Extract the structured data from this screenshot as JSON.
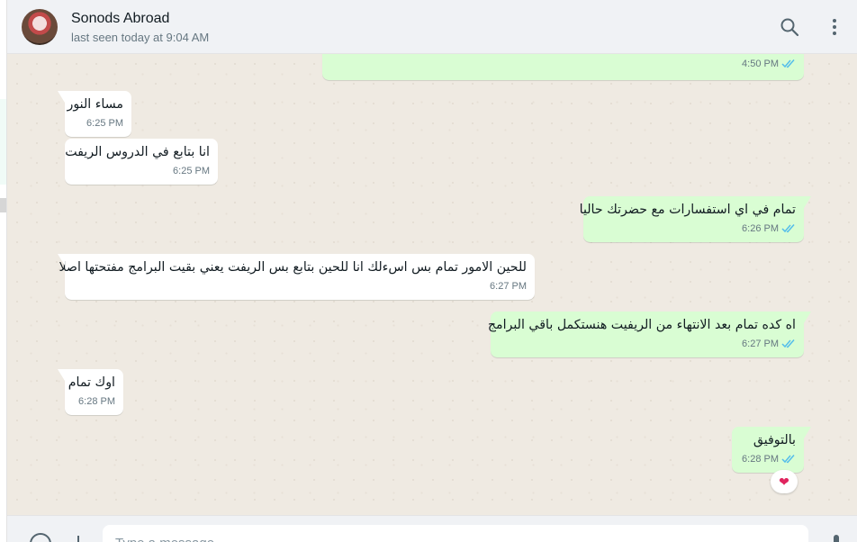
{
  "header": {
    "contact_name": "Sonods Abroad",
    "status": "last seen today at 9:04 AM",
    "icons": [
      "search-icon",
      "menu-icon"
    ]
  },
  "messages": [
    {
      "direction": "out",
      "text": "",
      "time": "4:50 PM",
      "read": true
    },
    {
      "direction": "in",
      "text": "مساء النور",
      "time": "6:25 PM"
    },
    {
      "direction": "in",
      "text": "انا بتابع في الدروس الريفت",
      "time": "6:25 PM"
    },
    {
      "direction": "out",
      "text": "تمام في اي استفسارات مع حضرتك حاليا",
      "time": "6:26 PM",
      "read": true
    },
    {
      "direction": "in",
      "text": "للحين الامور تمام بس اسءلك انا للحين بتابع بس الريفت يعني بقيت البرامج مفتحتها اصلا",
      "time": "6:27 PM"
    },
    {
      "direction": "out",
      "text": "اه كده تمام بعد الانتهاء من الريفيت هنستكمل باقي البرامج",
      "time": "6:27 PM",
      "read": true
    },
    {
      "direction": "in",
      "text": "اوك تمام",
      "time": "6:28 PM"
    },
    {
      "direction": "out",
      "text": "بالتوفيق",
      "time": "6:28 PM",
      "read": true,
      "reaction": "❤"
    }
  ],
  "composer": {
    "placeholder": "Type a message",
    "icons": [
      "emoji-icon",
      "attach-plus-icon",
      "mic-icon"
    ]
  },
  "colors": {
    "incoming_bubble": "#ffffff",
    "outgoing_bubble": "#d9fdd3",
    "chat_background": "#efeae2",
    "read_ticks": "#53bdeb"
  }
}
